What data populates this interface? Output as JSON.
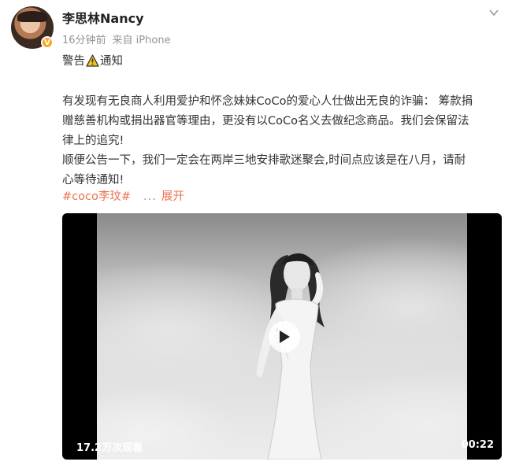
{
  "post": {
    "author": "李思林Nancy",
    "time": "16分钟前",
    "source": "来自 iPhone",
    "verified_badge": "V",
    "warning_title": {
      "before": "警告",
      "after": "通知"
    },
    "paragraph_lines": [
      "有发现有无良商人利用爱护和怀念妹妹CoCo的爱心人仕做出无良的诈骗：  筹款捐",
      "赠慈善机构或捐出器官等理由，更没有以CoCo名义去做纪念商品。我们会保留法",
      "律上的追究!",
      "顺便公告一下，我们一定会在两岸三地安排歌迷聚会,时间点应该是在八月，请耐",
      "心等待通知!"
    ],
    "hashtag": "#coco李玟#",
    "more_dots": "...",
    "expand_label": "展开"
  },
  "video": {
    "views": "17.2万次观看",
    "duration": "00:22"
  },
  "icons": {
    "warning": "warning-triangle-icon",
    "dropdown": "chevron-down-icon",
    "play": "play-icon",
    "verified": "verified-badge-icon"
  },
  "colors": {
    "link": "#eb7350",
    "meta": "#939393",
    "warning_yellow": "#f5c518",
    "verified": "#f5a623"
  }
}
